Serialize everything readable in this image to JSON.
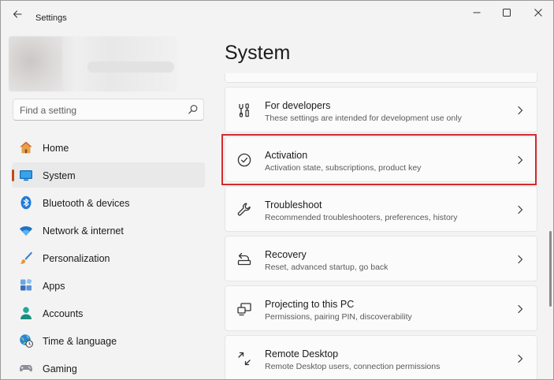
{
  "window": {
    "title": "Settings",
    "icons": {
      "back": "back-arrow-icon",
      "minimize": "minimize-icon",
      "maximize": "maximize-icon",
      "close": "close-icon"
    }
  },
  "search": {
    "placeholder": "Find a setting",
    "value": ""
  },
  "sidebar": {
    "items": [
      {
        "label": "Home",
        "icon": "home-icon",
        "selected": false
      },
      {
        "label": "System",
        "icon": "system-monitor-icon",
        "selected": true
      },
      {
        "label": "Bluetooth & devices",
        "icon": "bluetooth-icon",
        "selected": false
      },
      {
        "label": "Network & internet",
        "icon": "wifi-icon",
        "selected": false
      },
      {
        "label": "Personalization",
        "icon": "paintbrush-icon",
        "selected": false
      },
      {
        "label": "Apps",
        "icon": "apps-icon",
        "selected": false
      },
      {
        "label": "Accounts",
        "icon": "person-icon",
        "selected": false
      },
      {
        "label": "Time & language",
        "icon": "globe-clock-icon",
        "selected": false
      },
      {
        "label": "Gaming",
        "icon": "gamepad-icon",
        "selected": false
      }
    ]
  },
  "main": {
    "title": "System",
    "cards": [
      {
        "title": "For developers",
        "subtitle": "These settings are intended for development use only",
        "icon": "developer-tools-icon"
      },
      {
        "title": "Activation",
        "subtitle": "Activation state, subscriptions, product key",
        "icon": "check-circle-icon",
        "highlighted": true
      },
      {
        "title": "Troubleshoot",
        "subtitle": "Recommended troubleshooters, preferences, history",
        "icon": "wrench-icon"
      },
      {
        "title": "Recovery",
        "subtitle": "Reset, advanced startup, go back",
        "icon": "recovery-icon"
      },
      {
        "title": "Projecting to this PC",
        "subtitle": "Permissions, pairing PIN, discoverability",
        "icon": "projecting-icon"
      },
      {
        "title": "Remote Desktop",
        "subtitle": "Remote Desktop users, connection permissions",
        "icon": "remote-desktop-icon"
      }
    ]
  },
  "colors": {
    "highlight": "#d32a2f",
    "accent": "#c14a1b",
    "system_blue": "#0078d4"
  }
}
